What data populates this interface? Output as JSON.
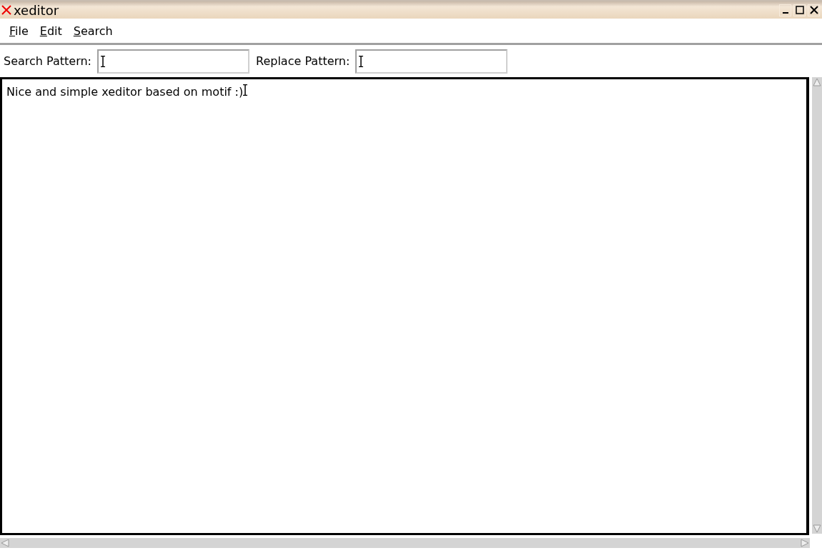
{
  "window": {
    "title": "xeditor"
  },
  "menu": [
    {
      "label": "File",
      "mnemonic_underlined": true
    },
    {
      "label": "Edit",
      "mnemonic_underlined": true
    },
    {
      "label": "Search",
      "mnemonic_underlined": true
    }
  ],
  "search_pattern": {
    "label": "Search Pattern:"
  },
  "replace_pattern": {
    "label": "Replace Pattern:"
  },
  "editor": {
    "text": "Nice and simple xeditor based on motif :)"
  }
}
